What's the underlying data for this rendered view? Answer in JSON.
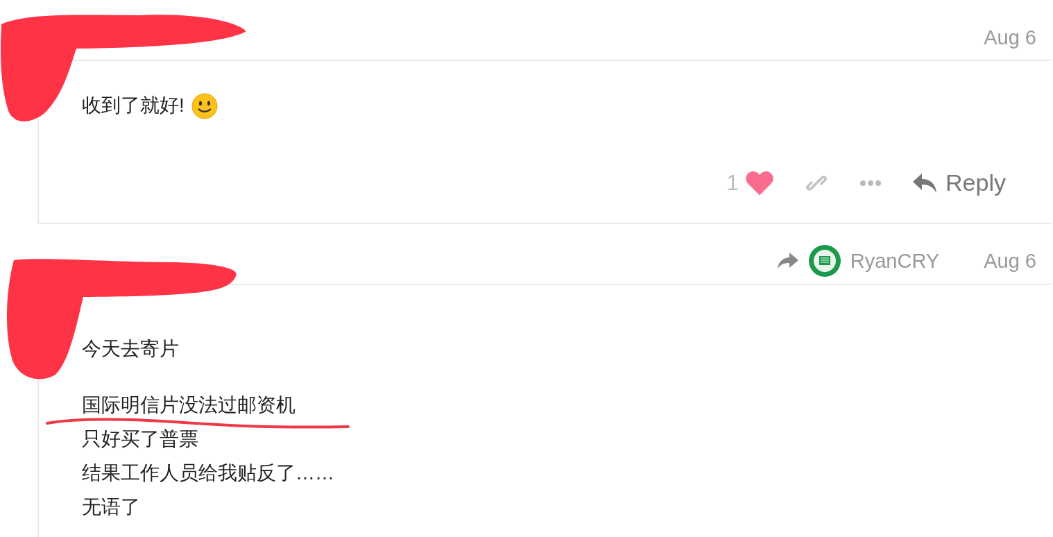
{
  "posts": [
    {
      "date": "Aug 6",
      "paragraphs": [
        [
          "收到了就好!"
        ]
      ],
      "emoji": true,
      "actions": {
        "like_count": "1",
        "liked": true,
        "reply": "Reply"
      }
    },
    {
      "date": "Aug 6",
      "reply_to": {
        "name": "RyanCRY"
      },
      "paragraphs": [
        [
          "今天去寄片"
        ],
        [
          "国际明信片没法过邮资机",
          "只好买了普票",
          "结果工作人员给我贴反了……",
          "无语了"
        ]
      ],
      "emoji": false
    }
  ]
}
